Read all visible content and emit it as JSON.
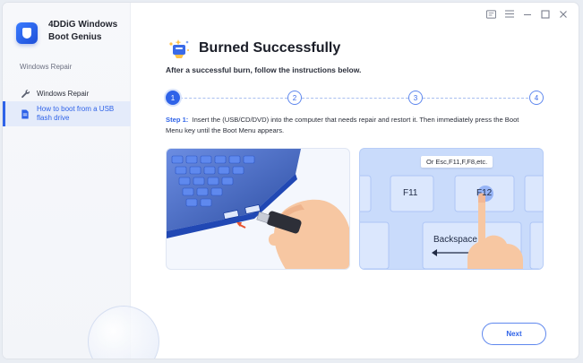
{
  "app": {
    "name": "4DDiG Windows Boot Genius"
  },
  "window_controls": {
    "icons": [
      "feedback-icon",
      "menu-icon",
      "minimize-icon",
      "maximize-icon",
      "close-icon"
    ]
  },
  "sidebar": {
    "section_title": "Windows Repair",
    "items": [
      {
        "label": "Windows Repair",
        "icon": "wrench-icon",
        "active": false
      },
      {
        "label": "How to boot from a USB flash drive",
        "icon": "document-icon",
        "active": true
      }
    ]
  },
  "main": {
    "title": "Burned Successfully",
    "subtitle": "After a successful burn, follow the instructions below.",
    "steps": [
      "1",
      "2",
      "3",
      "4"
    ],
    "active_step": 1,
    "step_label": "Step 1:",
    "step_text": "Insert the (USB/CD/DVD) into the computer that needs repair and restort it. Then immediately press the Boot Menu key until the Boot Menu appears.",
    "keyboard_tooltip": "Or Esc,F11,F,F8,etc.",
    "key_f11": "F11",
    "key_f12": "F12",
    "key_backspace": "Backspace",
    "next_button": "Next"
  },
  "colors": {
    "accent": "#2f63e8",
    "sidebar_active_bg": "#e4ebfa",
    "illustration_blue": "#c9dbfb"
  }
}
